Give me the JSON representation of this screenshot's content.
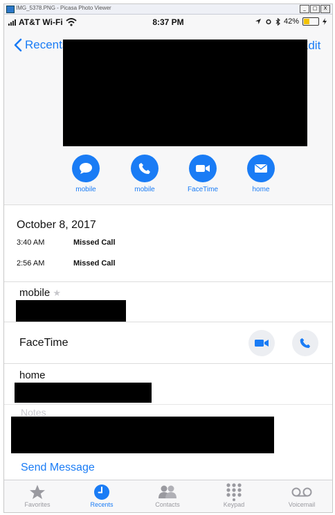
{
  "window": {
    "title": "IMG_5378.PNG - Picasa Photo Viewer",
    "min_label": "_",
    "max_label": "□",
    "close_label": "X"
  },
  "status_bar": {
    "carrier": "AT&T Wi-Fi",
    "time": "8:37 PM",
    "battery": "42%",
    "battery_level": 0.42
  },
  "nav": {
    "back_label": "Recents",
    "edit_label": "Edit"
  },
  "actions": [
    {
      "label": "mobile",
      "icon": "message-icon"
    },
    {
      "label": "mobile",
      "icon": "phone-icon"
    },
    {
      "label": "FaceTime",
      "icon": "video-icon"
    },
    {
      "label": "home",
      "icon": "mail-icon"
    }
  ],
  "call_log": {
    "date": "October 8, 2017",
    "entries": [
      {
        "time": "3:40 AM",
        "type": "Missed Call"
      },
      {
        "time": "2:56 AM",
        "type": "Missed Call"
      }
    ]
  },
  "fields": {
    "mobile_label": "mobile",
    "favorite_marker": "★",
    "facetime_label": "FaceTime",
    "home_label": "home",
    "notes_label": "Notes"
  },
  "send_message_label": "Send Message",
  "tabs": [
    {
      "label": "Favorites",
      "icon": "star-icon",
      "active": false
    },
    {
      "label": "Recents",
      "icon": "clock-icon",
      "active": true
    },
    {
      "label": "Contacts",
      "icon": "contacts-icon",
      "active": false
    },
    {
      "label": "Keypad",
      "icon": "keypad-icon",
      "active": false
    },
    {
      "label": "Voicemail",
      "icon": "voicemail-icon",
      "active": false
    }
  ],
  "colors": {
    "accent": "#1a7cf5",
    "redaction": "#000000",
    "battery_fill": "#f2c200"
  }
}
